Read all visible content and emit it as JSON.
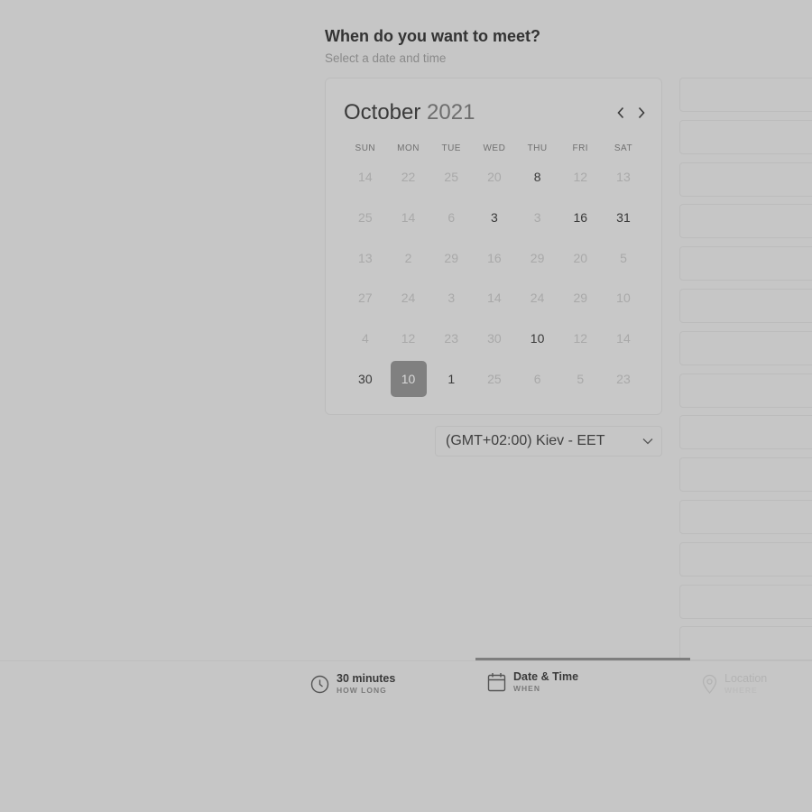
{
  "header": {
    "question": "When do you want to meet?",
    "subtitle": "Select a date and time"
  },
  "calendar": {
    "month": "October",
    "year": "2021",
    "weekdays": [
      "SUN",
      "MON",
      "TUE",
      "WED",
      "THU",
      "FRI",
      "SAT"
    ],
    "weeks": [
      [
        "14",
        "22",
        "25",
        "20",
        "8",
        "12",
        "13"
      ],
      [
        "25",
        "14",
        "6",
        "3",
        "3",
        "16",
        "31"
      ],
      [
        "13",
        "2",
        "29",
        "16",
        "29",
        "20",
        "5"
      ],
      [
        "27",
        "24",
        "3",
        "14",
        "24",
        "29",
        "10"
      ],
      [
        "4",
        "12",
        "23",
        "30",
        "10",
        "12",
        "14"
      ],
      [
        "30",
        "10",
        "1",
        "25",
        "6",
        "5",
        "23"
      ]
    ],
    "available": [
      [
        0,
        4
      ],
      [
        1,
        3
      ],
      [
        1,
        5
      ],
      [
        1,
        6
      ],
      [
        4,
        4
      ],
      [
        5,
        0
      ],
      [
        5,
        2
      ]
    ],
    "selected": [
      5,
      1
    ],
    "prev_icon": "chevron-left-icon",
    "next_icon": "chevron-right-icon"
  },
  "timezone": {
    "value": "(GMT+02:00) Kiev - EET",
    "icon": "chevron-down-icon"
  },
  "time_slots": {
    "count": 14
  },
  "steps": [
    {
      "label": "30 minutes",
      "sub": "HOW LONG",
      "icon": "clock-icon",
      "state": "done"
    },
    {
      "label": "Date & Time",
      "sub": "WHEN",
      "icon": "calendar-icon",
      "state": "active"
    },
    {
      "label": "Location",
      "sub": "WHERE",
      "icon": "location-pin-icon",
      "state": "inactive"
    }
  ],
  "colors": {
    "background": "#c6c6c6",
    "selected_day": "#808080",
    "progress": "#7e7e7e"
  }
}
